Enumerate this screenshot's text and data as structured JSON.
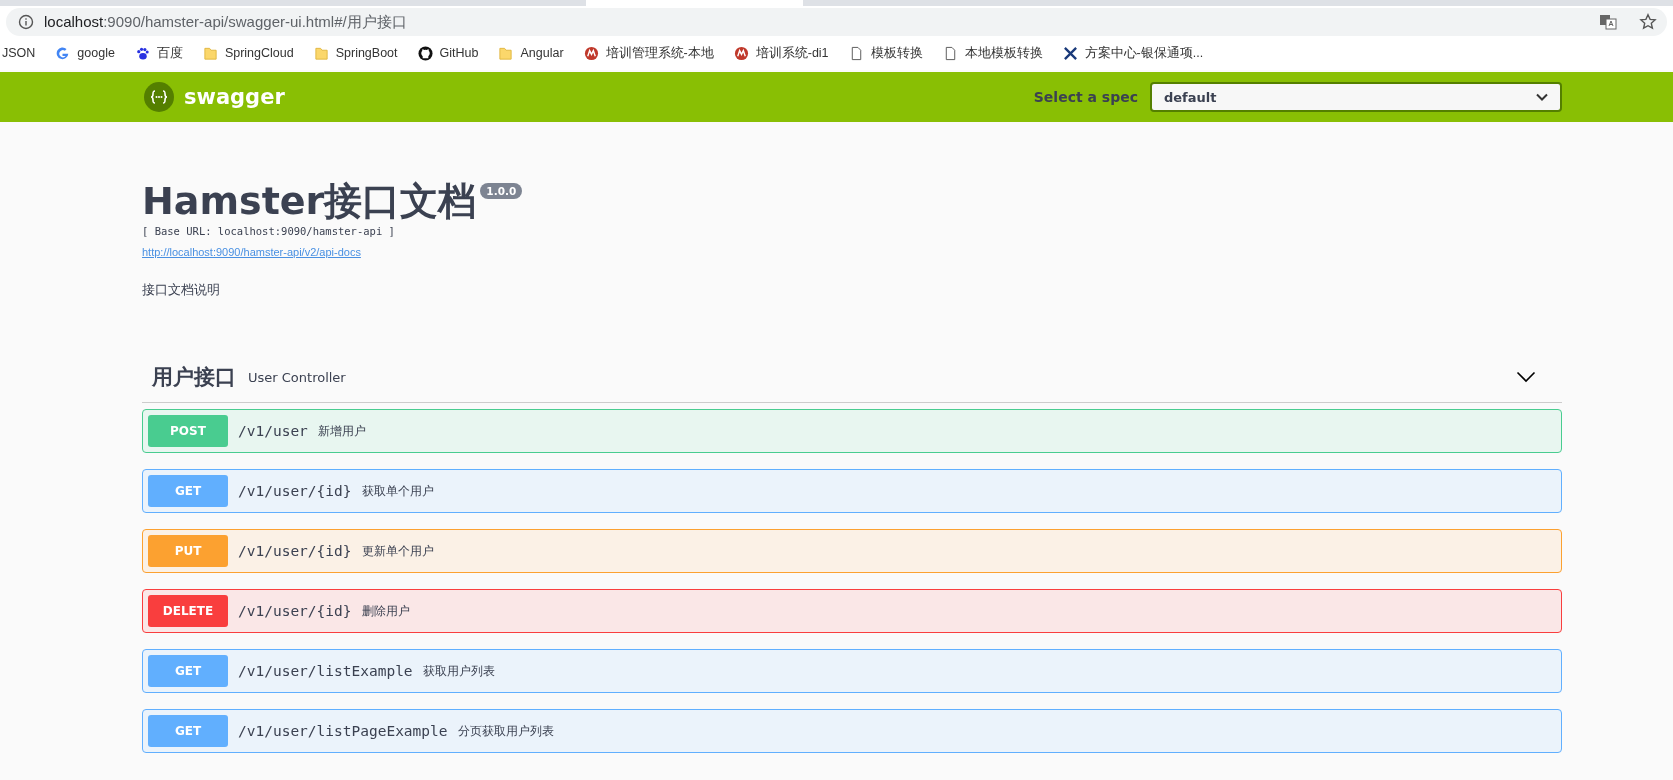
{
  "browser": {
    "address_host": "localhost",
    "address_rest": ":9090/hamster-api/swagger-ui.html#/用户接口",
    "bookmarks": [
      {
        "kind": "text",
        "label": "JSON"
      },
      {
        "kind": "google",
        "label": "google"
      },
      {
        "kind": "paw",
        "label": "百度"
      },
      {
        "kind": "folder",
        "label": "SpringCloud"
      },
      {
        "kind": "folder",
        "label": "SpringBoot"
      },
      {
        "kind": "github",
        "label": "GitHub"
      },
      {
        "kind": "folder",
        "label": "Angular"
      },
      {
        "kind": "badge",
        "label": "培训管理系统-本地"
      },
      {
        "kind": "badge",
        "label": "培训系统-di1"
      },
      {
        "kind": "page",
        "label": "模板转换"
      },
      {
        "kind": "page",
        "label": "本地模板转换"
      },
      {
        "kind": "tools",
        "label": "方案中心-银保通项..."
      }
    ]
  },
  "topbar": {
    "brand": "swagger",
    "spec_label": "Select a spec",
    "spec_value": "default"
  },
  "info": {
    "title": "Hamster接口文档",
    "version": "1.0.0",
    "base_url": "[ Base URL: localhost:9090/hamster-api ]",
    "docs_link": "http://localhost:9090/hamster-api/v2/api-docs",
    "description": "接口文档说明"
  },
  "tag": {
    "name": "用户接口",
    "description": "User Controller",
    "expanded": true,
    "operations": [
      {
        "method": "POST",
        "path": "/v1/user",
        "summary": "新增用户"
      },
      {
        "method": "GET",
        "path": "/v1/user/{id}",
        "summary": "获取单个用户"
      },
      {
        "method": "PUT",
        "path": "/v1/user/{id}",
        "summary": "更新单个用户"
      },
      {
        "method": "DELETE",
        "path": "/v1/user/{id}",
        "summary": "删除用户"
      },
      {
        "method": "GET",
        "path": "/v1/user/listExample",
        "summary": "获取用户列表"
      },
      {
        "method": "GET",
        "path": "/v1/user/listPageExample",
        "summary": "分页获取用户列表"
      }
    ]
  }
}
